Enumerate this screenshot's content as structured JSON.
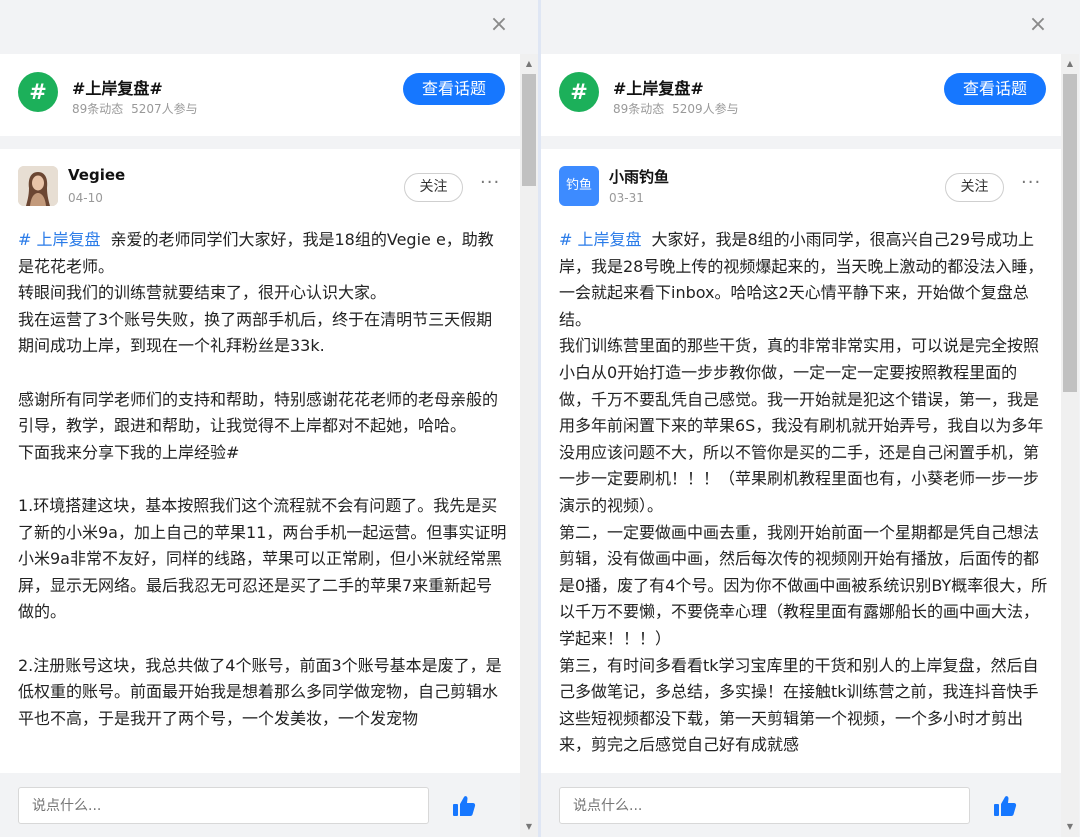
{
  "left": {
    "close_label": "×",
    "topic": {
      "icon": "#",
      "title": "#上岸复盘#",
      "dynamic_count": "89条动态",
      "participant_count": "5207人参与",
      "view_button": "查看话题"
    },
    "post": {
      "author": "Vegiee",
      "date": "04-10",
      "follow": "关注",
      "more": "···",
      "hashtag": "# 上岸复盘",
      "paragraphs": [
        "亲爱的老师同学们大家好，我是18组的Vegie e，助教是花花老师。",
        "转眼间我们的训练营就要结束了，很开心认识大家。",
        "我在运营了3个账号失败，换了两部手机后，终于在清明节三天假期期间成功上岸，到现在一个礼拜粉丝是33k.",
        "",
        "感谢所有同学老师们的支持和帮助，特别感谢花花老师的老母亲般的引导，教学，跟进和帮助，让我觉得不上岸都对不起她，哈哈。",
        "下面我来分享下我的上岸经验#",
        "",
        "1.环境搭建这块，基本按照我们这个流程就不会有问题了。我先是买了新的小米9a，加上自己的苹果11，两台手机一起运营。但事实证明小米9a非常不友好，同样的线路，苹果可以正常刷，但小米就经常黑屏，显示无网络。最后我忍无可忍还是买了二手的苹果7来重新起号做的。",
        "",
        "2.注册账号这块，我总共做了4个账号，前面3个账号基本是废了，是低权重的账号。前面最开始我是想着那么多同学做宠物，自己剪辑水平也不高，于是我开了两个号，一个发美妆，一个发宠物"
      ]
    },
    "comment_placeholder": "说点什么..."
  },
  "right": {
    "close_label": "×",
    "topic": {
      "icon": "#",
      "title": "#上岸复盘#",
      "dynamic_count": "89条动态",
      "participant_count": "5209人参与",
      "view_button": "查看话题"
    },
    "post": {
      "author": "小雨钓鱼",
      "avatar_text": "钓鱼",
      "date": "03-31",
      "follow": "关注",
      "more": "···",
      "hashtag": "# 上岸复盘",
      "paragraphs": [
        "大家好，我是8组的小雨同学，很高兴自己29号成功上岸，我是28号晚上传的视频爆起来的，当天晚上激动的都没法入睡，一会就起来看下inbox。哈哈这2天心情平静下来，开始做个复盘总结。",
        "我们训练营里面的那些干货，真的非常非常实用，可以说是完全按照小白从0开始打造一步步教你做，一定一定一定要按照教程里面的做，千万不要乱凭自己感觉。我一开始就是犯这个错误，第一，我是用多年前闲置下来的苹果6S，我没有刷机就开始弄号，我自以为多年没用应该问题不大，所以不管你是买的二手，还是自己闲置手机，第一步一定要刷机！！！（苹果刷机教程里面也有，小葵老师一步一步演示的视频）。",
        "第二，一定要做画中画去重，我刚开始前面一个星期都是凭自己想法剪辑，没有做画中画，然后每次传的视频刚开始有播放，后面传的都是0播，废了有4个号。因为你不做画中画被系统识别BY概率很大，所以千万不要懒，不要侥幸心理（教程里面有露娜船长的画中画大法，学起来！！！）",
        "第三，有时间多看看tk学习宝库里的干货和别人的上岸复盘，然后自己多做笔记，多总结，多实操！在接触tk训练营之前，我连抖音快手这些短视频都没下载，第一天剪辑第一个视频，一个多小时才剪出来，剪完之后感觉自己好有成就感"
      ]
    },
    "comment_placeholder": "说点什么..."
  },
  "colors": {
    "accent": "#1677ff",
    "topic_icon": "#1cb05a",
    "hashtag": "#2a7be8",
    "background": "#f2f3f5"
  }
}
